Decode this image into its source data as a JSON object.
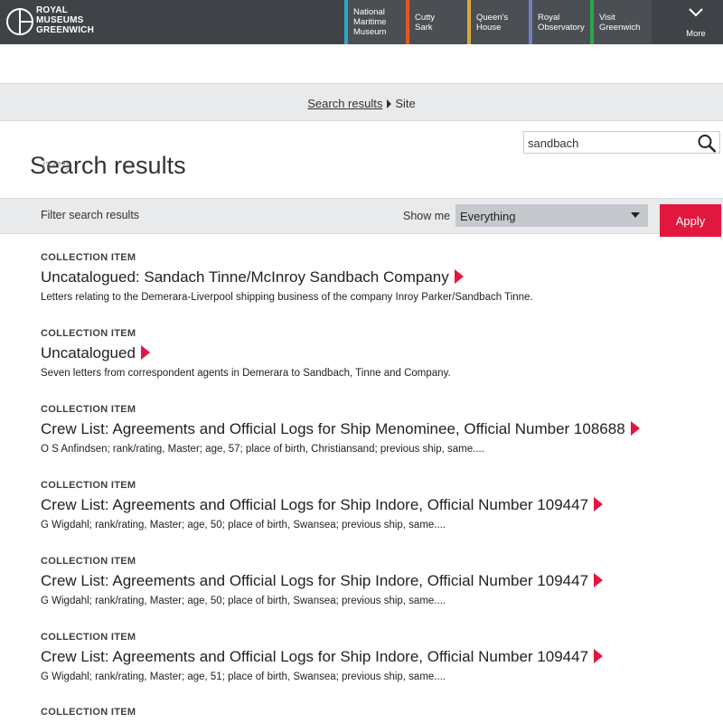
{
  "header": {
    "logo_lines": [
      "ROYAL",
      "MUSEUMS",
      "GREENWICH"
    ],
    "nav": [
      {
        "label": "National\nMaritime\nMuseum",
        "color": "#2aa8c7"
      },
      {
        "label": "Cutty\nSark",
        "color": "#e2572a"
      },
      {
        "label": "Queen's\nHouse",
        "color": "#d9a93c"
      },
      {
        "label": "Royal\nObservatory",
        "color": "#6f7fbd"
      },
      {
        "label": "Visit\nGreenwich",
        "color": "#27a94a"
      }
    ],
    "more_label": "More"
  },
  "breadcrumb": {
    "link": "Search results",
    "current": "Site"
  },
  "search": {
    "value": "sandbach",
    "ghost_text": "(????)"
  },
  "page_title": "Search results",
  "filter": {
    "label": "Filter search results",
    "show_me_label": "Show me",
    "selected": "Everything",
    "apply_label": "Apply",
    "accent": "#e2173e"
  },
  "results": [
    {
      "type": "COLLECTION ITEM",
      "title": "Uncatalogued: Sandach Tinne/McInroy Sandbach Company",
      "description": "Letters relating to the Demerara-Liverpool shipping business of the company Inroy Parker/Sandbach Tinne."
    },
    {
      "type": "COLLECTION ITEM",
      "title": "Uncatalogued",
      "description": "Seven letters from correspondent agents in Demerara to Sandbach, Tinne and Company."
    },
    {
      "type": "COLLECTION ITEM",
      "title": "Crew List: Agreements and Official Logs for Ship Menominee, Official Number 108688",
      "description": "O S Anfindsen; rank/rating, Master; age, 57; place of birth, Christiansand; previous ship, same...."
    },
    {
      "type": "COLLECTION ITEM",
      "title": "Crew List: Agreements and Official Logs for Ship Indore, Official Number 109447",
      "description": "G Wigdahl; rank/rating, Master; age, 50; place of birth, Swansea; previous ship, same...."
    },
    {
      "type": "COLLECTION ITEM",
      "title": "Crew List: Agreements and Official Logs for Ship Indore, Official Number 109447",
      "description": "G Wigdahl; rank/rating, Master; age, 50; place of birth, Swansea; previous ship, same...."
    },
    {
      "type": "COLLECTION ITEM",
      "title": "Crew List: Agreements and Official Logs for Ship Indore, Official Number 109447",
      "description": "G Wigdahl; rank/rating, Master; age, 51; place of birth, Swansea; previous ship, same...."
    },
    {
      "type": "COLLECTION ITEM",
      "title": "",
      "description": ""
    }
  ]
}
